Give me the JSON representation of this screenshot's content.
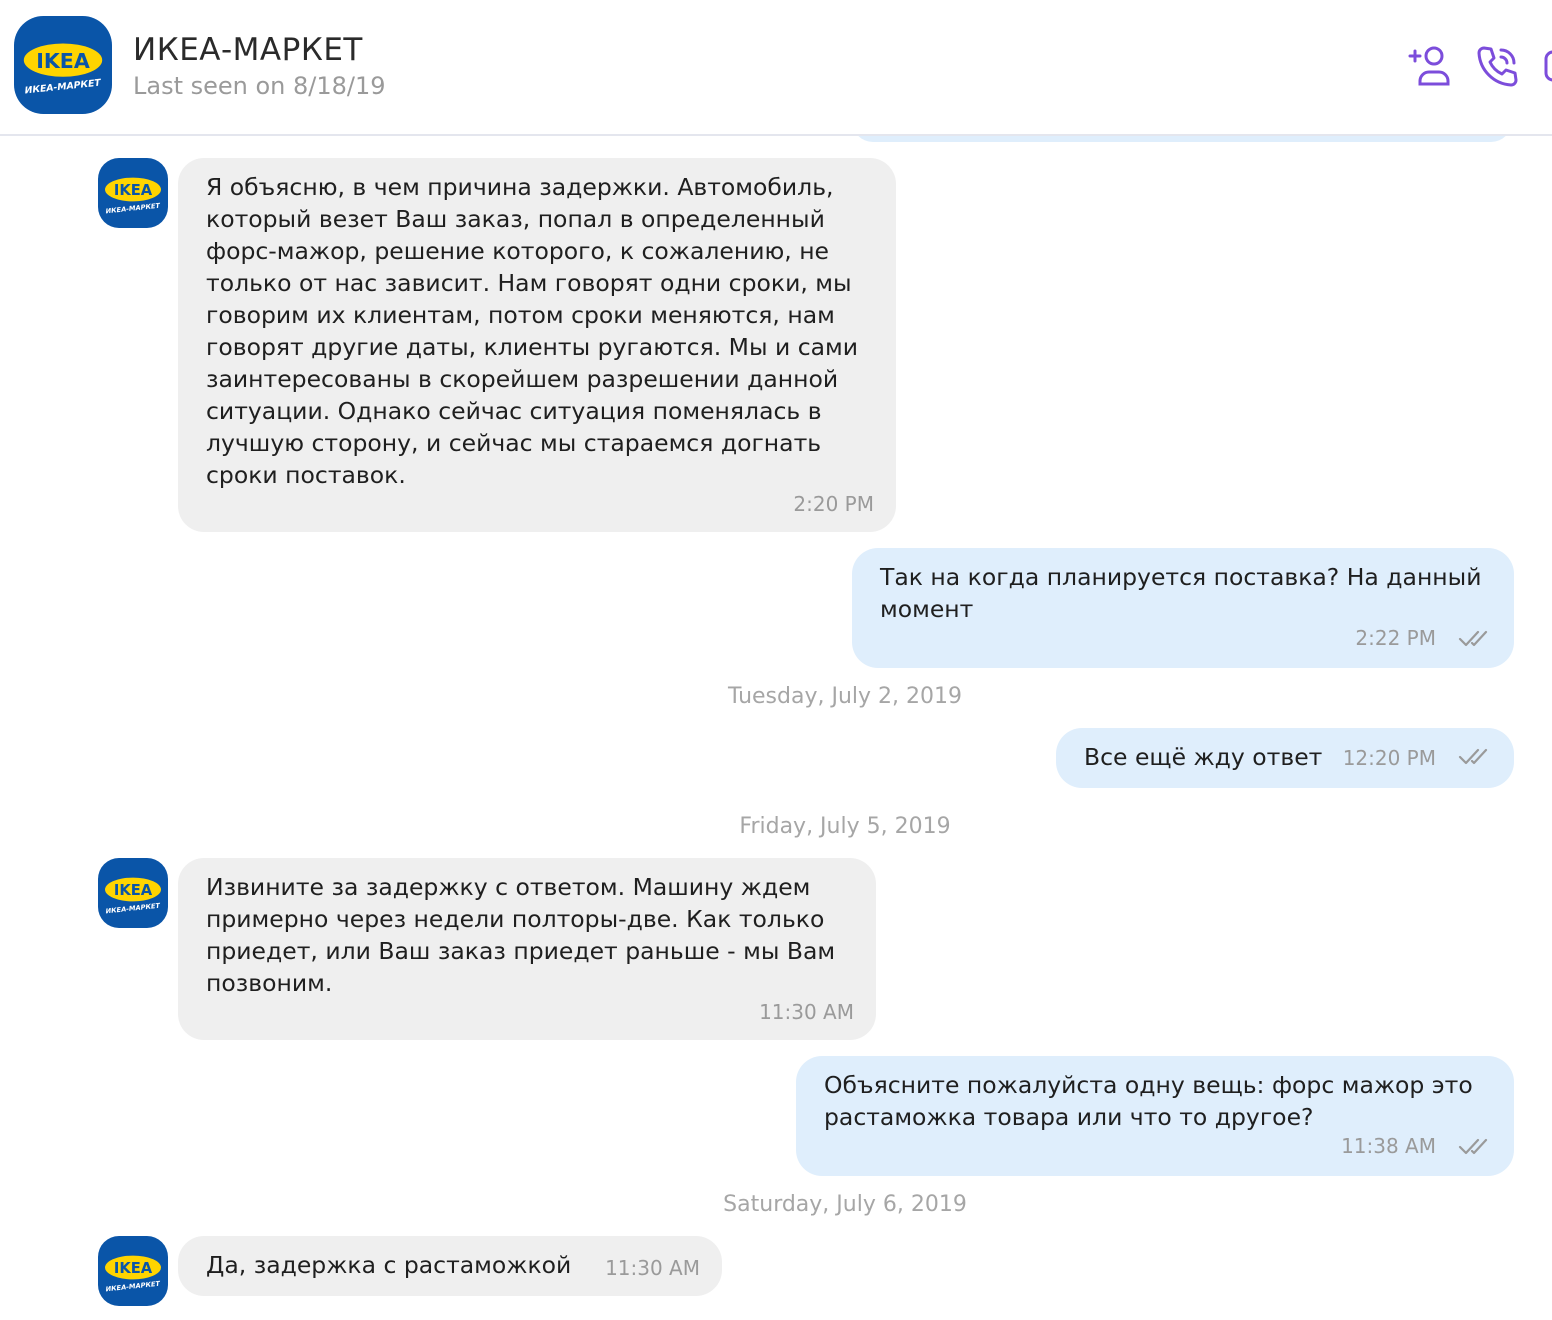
{
  "header": {
    "name": "ИКЕА-МАРКЕТ",
    "status": "Last seen on 8/18/19",
    "logo_text_top": "IKEA",
    "logo_text_bottom": "ИКЕА-МАРКЕТ",
    "actions": [
      "add-contact-icon",
      "phone-icon",
      "video-icon"
    ]
  },
  "colors": {
    "accent": "#7c4ddb",
    "incoming_bubble": "#efefef",
    "outgoing_bubble": "#dfeefc",
    "ikea_blue": "#0a55a8",
    "ikea_yellow": "#ffd400"
  },
  "messages": [
    {
      "from": "ИКЕА-МАРКЕТ",
      "direction": "incoming",
      "text": "Я объясню, в чем причина задержки. Автомобиль, который везет Ваш заказ, попал в определенный форс-мажор, решение которого, к сожалению, не только от нас зависит. Нам говорят одни сроки, мы говорим их клиентам, потом сроки меняются, нам говорят другие даты, клиенты ругаются. Мы и сами заинтересованы в скорейшем разрешении данной ситуации. Однако сейчас ситуация поменялась в лучшую сторону, и сейчас мы стараемся догнать сроки поставок.",
      "time": "2:20 PM"
    },
    {
      "direction": "outgoing",
      "text": "Так на когда планируется поставка? На данный момент",
      "time": "2:22 PM"
    },
    {
      "direction": "outgoing",
      "text": "Все ещё жду ответ",
      "time": "12:20 PM"
    },
    {
      "from": "ИКЕА-МАРКЕТ",
      "direction": "incoming",
      "text": "Извините за задержку с ответом. Машину ждем примерно через недели полторы-две. Как только приедет, или Ваш заказ приедет раньше - мы Вам позвоним.",
      "time": "11:30 AM"
    },
    {
      "direction": "outgoing",
      "text": "Объясните пожалуйста одну вещь: форс мажор это растаможка товара или что то другое?",
      "time": "11:38 AM"
    },
    {
      "from": "ИКЕА-МАРКЕТ",
      "direction": "incoming",
      "text": "Да, задержка с растаможкой",
      "time": "11:30 AM"
    }
  ],
  "date_separators": [
    "Tuesday, July 2, 2019",
    "Friday, July 5, 2019",
    "Saturday, July 6, 2019"
  ]
}
